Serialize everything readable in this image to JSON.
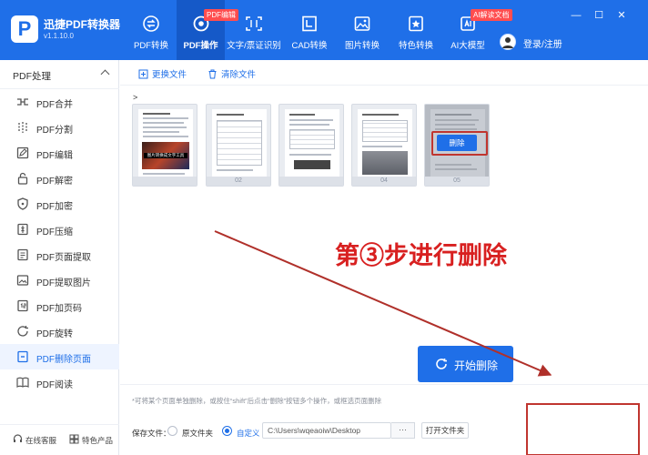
{
  "app": {
    "title": "迅捷PDF转换器",
    "version": "v1.1.10.0",
    "logo": "P",
    "brand_color": "#1f6fe8"
  },
  "nav": [
    {
      "label": "PDF转换",
      "icon": "swap-icon",
      "tag": ""
    },
    {
      "label": "PDF操作",
      "icon": "gear-doc-icon",
      "tag": "PDF编辑",
      "active": true
    },
    {
      "label": "文字/票证识别",
      "icon": "scan-icon",
      "tag": ""
    },
    {
      "label": "CAD转换",
      "icon": "cad-icon",
      "tag": ""
    },
    {
      "label": "图片转换",
      "icon": "image-icon",
      "tag": ""
    },
    {
      "label": "特色转换",
      "icon": "star-doc-icon",
      "tag": ""
    },
    {
      "label": "AI大模型",
      "icon": "ai-icon",
      "tag": "AI解读文档"
    }
  ],
  "account": {
    "label": "登录/注册"
  },
  "window": {
    "minimize": "—",
    "maximize": "☐",
    "close": "✕"
  },
  "sidebar": {
    "title": "PDF处理",
    "items": [
      {
        "label": "PDF合并",
        "icon": "merge-icon"
      },
      {
        "label": "PDF分割",
        "icon": "split-icon"
      },
      {
        "label": "PDF编辑",
        "icon": "edit-icon"
      },
      {
        "label": "PDF解密",
        "icon": "unlock-icon"
      },
      {
        "label": "PDF加密",
        "icon": "shield-icon"
      },
      {
        "label": "PDF压缩",
        "icon": "compress-icon"
      },
      {
        "label": "PDF页面提取",
        "icon": "extract-page-icon"
      },
      {
        "label": "PDF提取图片",
        "icon": "extract-image-icon"
      },
      {
        "label": "PDF加页码",
        "icon": "page-number-icon"
      },
      {
        "label": "PDF旋转",
        "icon": "rotate-icon"
      },
      {
        "label": "PDF删除页面",
        "icon": "delete-page-icon",
        "active": true
      },
      {
        "label": "PDF阅读",
        "icon": "read-icon"
      }
    ],
    "footer": {
      "service": "在线客服",
      "products": "特色产品"
    }
  },
  "toolbar": {
    "replace": "更换文件",
    "clear": "清除文件"
  },
  "breadcrumb": ">",
  "pages": [
    {
      "number": "",
      "caption": "图片转换成文字工具"
    },
    {
      "number": "02",
      "caption": ""
    },
    {
      "number": "",
      "caption": ""
    },
    {
      "number": "04",
      "caption": ""
    },
    {
      "number": "05",
      "caption": ""
    }
  ],
  "page_delete_label": "删除",
  "annotation": "第③步进行删除",
  "annotation_color": "#d82020",
  "bottom": {
    "hint": "*可将某个页面单独删除，或按住“shift”后点击“删除”按钮多个操作，或框选页面删除",
    "save_label": "保存文件：",
    "option_original": "原文件夹",
    "option_custom": "自定义",
    "path": "C:\\Users\\wqeaoiw\\Desktop",
    "browse": "···",
    "open_folder": "打开文件夹",
    "start": "开始删除"
  }
}
